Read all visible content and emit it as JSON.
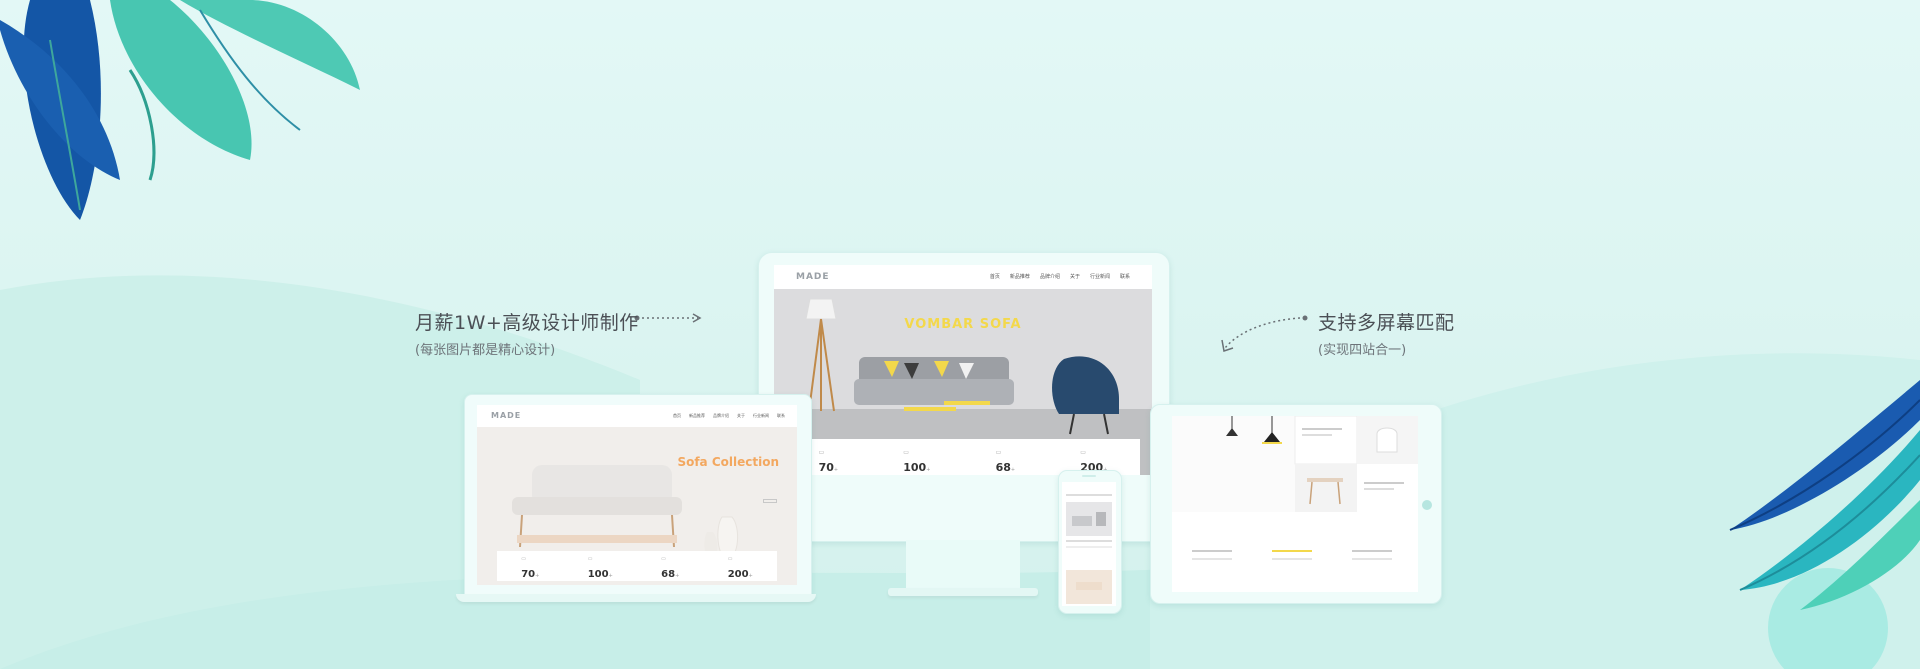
{
  "callouts": {
    "left": {
      "title": "月薪1W+高级设计师制作",
      "subtitle": "(每张图片都是精心设计)"
    },
    "right": {
      "title": "支持多屏幕匹配",
      "subtitle": "(实现四站合一)"
    }
  },
  "desktop": {
    "logo": "MADE",
    "nav": [
      "首页",
      "新品推荐",
      "品牌介绍",
      "关于",
      "行业新闻",
      "联系"
    ],
    "hero_title": "VOMBAR SOFA",
    "hero_subtitle": "",
    "stats": [
      {
        "value": "70",
        "unit": "+"
      },
      {
        "value": "100",
        "unit": "+"
      },
      {
        "value": "68",
        "unit": "+"
      },
      {
        "value": "200",
        "unit": "+"
      }
    ]
  },
  "laptop": {
    "logo": "MADE",
    "nav": [
      "首页",
      "新品推荐",
      "品牌介绍",
      "关于",
      "行业新闻",
      "联系"
    ],
    "hero_kicker": "",
    "hero_title": "Sofa Collection",
    "hero_button": "",
    "stats": [
      {
        "value": "70",
        "unit": "+"
      },
      {
        "value": "100",
        "unit": "+"
      },
      {
        "value": "68",
        "unit": "+"
      },
      {
        "value": "200",
        "unit": "+"
      }
    ]
  },
  "tablet": {
    "section_title": ""
  },
  "phone": {
    "title": ""
  },
  "colors": {
    "background": "#dff6f4",
    "leaf_teal": "#48c6b1",
    "leaf_blue": "#1456a6",
    "hero_yellow": "#f3d84b",
    "collection_orange": "#f3a860"
  },
  "icons": [
    "leaf-decoration-icon",
    "dotted-arrow-icon"
  ]
}
